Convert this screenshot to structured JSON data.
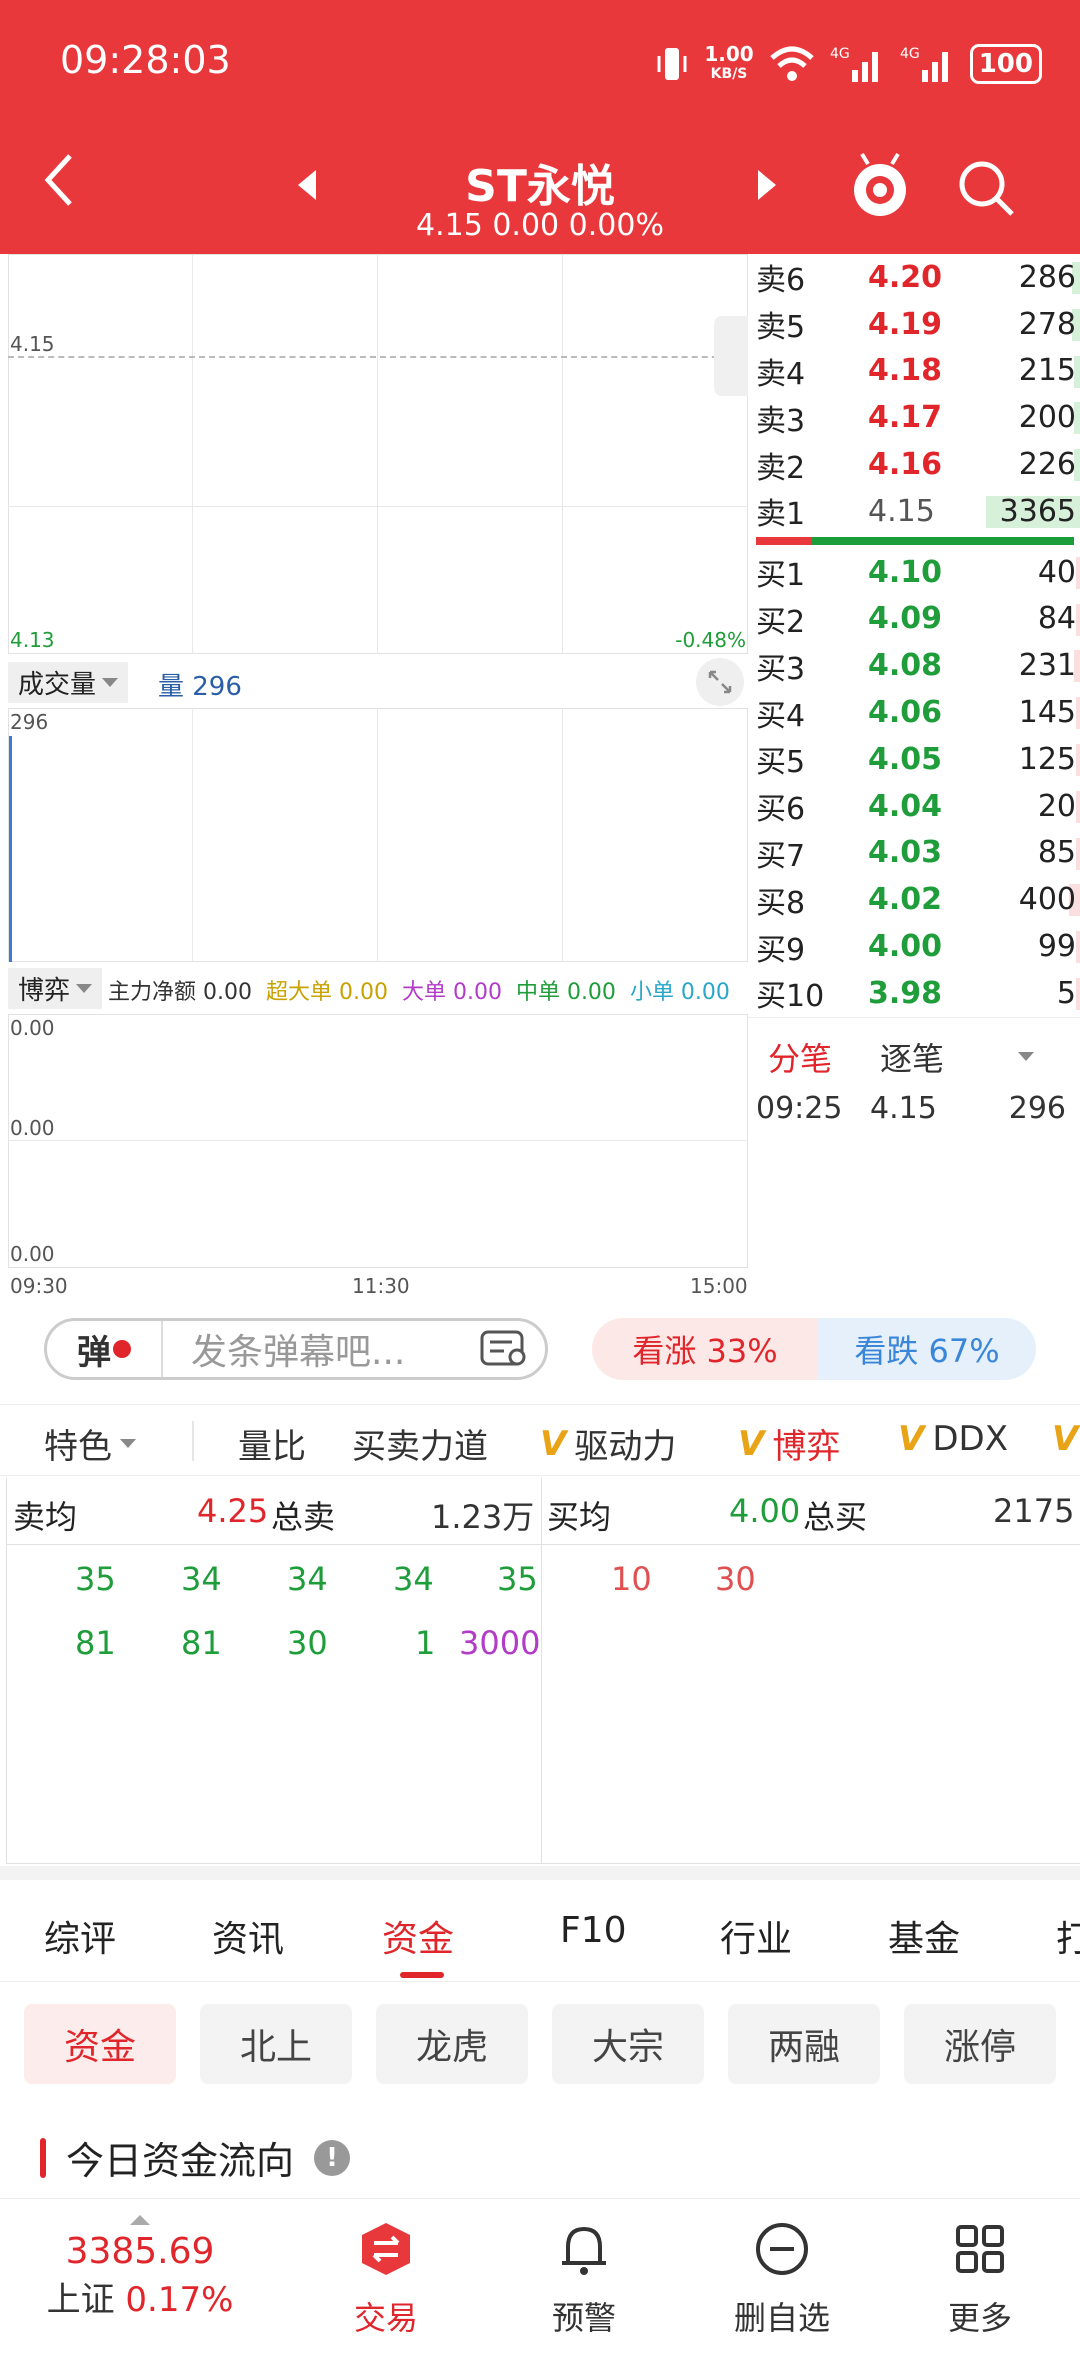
{
  "status": {
    "time": "09:28:03",
    "speed_value": "1.00",
    "speed_unit": "KB/S",
    "net1": "4G",
    "net2": "4G",
    "battery": "100"
  },
  "header": {
    "title": "ST永悦",
    "subtitle": "4.15 0.00 0.00%"
  },
  "chart": {
    "price_high": "4.15",
    "price_low": "4.13",
    "pct_low": "-0.48%",
    "volume_selector": "成交量",
    "volume_label": "量 296",
    "volume_axis_top": "296",
    "game_selector": "博弈",
    "main_net": "主力净额 0.00",
    "super_large": "超大单 0.00",
    "large": "大单 0.00",
    "medium": "中单 0.00",
    "small": "小单 0.00",
    "flow_axis": [
      "0.00",
      "0.00",
      "0.00"
    ],
    "time_start": "09:30",
    "time_mid": "11:30",
    "time_end": "15:00",
    "colors": {
      "up": "#e0262b",
      "down": "#1e9d3a",
      "super_large": "#c8a200",
      "large": "#b23cc8",
      "medium": "#1e9d3a",
      "small": "#2aa7c8"
    }
  },
  "orderbook": {
    "sells": [
      {
        "label": "卖6",
        "price": "4.20",
        "vol": "286"
      },
      {
        "label": "卖5",
        "price": "4.19",
        "vol": "278"
      },
      {
        "label": "卖4",
        "price": "4.18",
        "vol": "215"
      },
      {
        "label": "卖3",
        "price": "4.17",
        "vol": "200"
      },
      {
        "label": "卖2",
        "price": "4.16",
        "vol": "226"
      },
      {
        "label": "卖1",
        "price": "4.15",
        "vol": "3365"
      }
    ],
    "buys": [
      {
        "label": "买1",
        "price": "4.10",
        "vol": "40"
      },
      {
        "label": "买2",
        "price": "4.09",
        "vol": "84"
      },
      {
        "label": "买3",
        "price": "4.08",
        "vol": "231"
      },
      {
        "label": "买4",
        "price": "4.06",
        "vol": "145"
      },
      {
        "label": "买5",
        "price": "4.05",
        "vol": "125"
      },
      {
        "label": "买6",
        "price": "4.04",
        "vol": "20"
      },
      {
        "label": "买7",
        "price": "4.03",
        "vol": "85"
      },
      {
        "label": "买8",
        "price": "4.02",
        "vol": "400"
      },
      {
        "label": "买9",
        "price": "4.00",
        "vol": "99"
      },
      {
        "label": "买10",
        "price": "3.98",
        "vol": "5"
      }
    ],
    "tab_active": "分笔",
    "tab_other": "逐笔",
    "tick": {
      "time": "09:25",
      "price": "4.15",
      "vol": "296"
    }
  },
  "danmaku": {
    "badge": "弹",
    "placeholder": "发条弹幕吧...",
    "up": "看涨 33%",
    "down": "看跌 67%"
  },
  "feature_tabs": {
    "first": "特色",
    "items": [
      "量比",
      "买卖力道",
      "驱动力",
      "博弈",
      "DDX",
      ""
    ]
  },
  "stats": {
    "sell_avg_label": "卖均",
    "sell_avg": "4.25",
    "sell_total_label": "总卖",
    "sell_total": "1.23万",
    "buy_avg_label": "买均",
    "buy_avg": "4.00",
    "buy_total_label": "总买",
    "buy_total": "2175",
    "row1_sell": [
      "35",
      "34",
      "34",
      "34",
      "35"
    ],
    "row2_sell": [
      "81",
      "81",
      "30",
      "1",
      "3000"
    ],
    "row1_buy": [
      "10",
      "30"
    ]
  },
  "info_tabs": [
    "综评",
    "资讯",
    "资金",
    "F10",
    "行业",
    "基金",
    "打"
  ],
  "info_tab_active": "资金",
  "chips": [
    "资金",
    "北上",
    "龙虎",
    "大宗",
    "两融",
    "涨停"
  ],
  "section_title": "今日资金流向",
  "bottom_nav": {
    "index_value": "3385.69",
    "index_name": "上证",
    "index_pct": "0.17%",
    "trade": "交易",
    "alert": "预警",
    "remove_fav": "删自选",
    "more": "更多"
  }
}
